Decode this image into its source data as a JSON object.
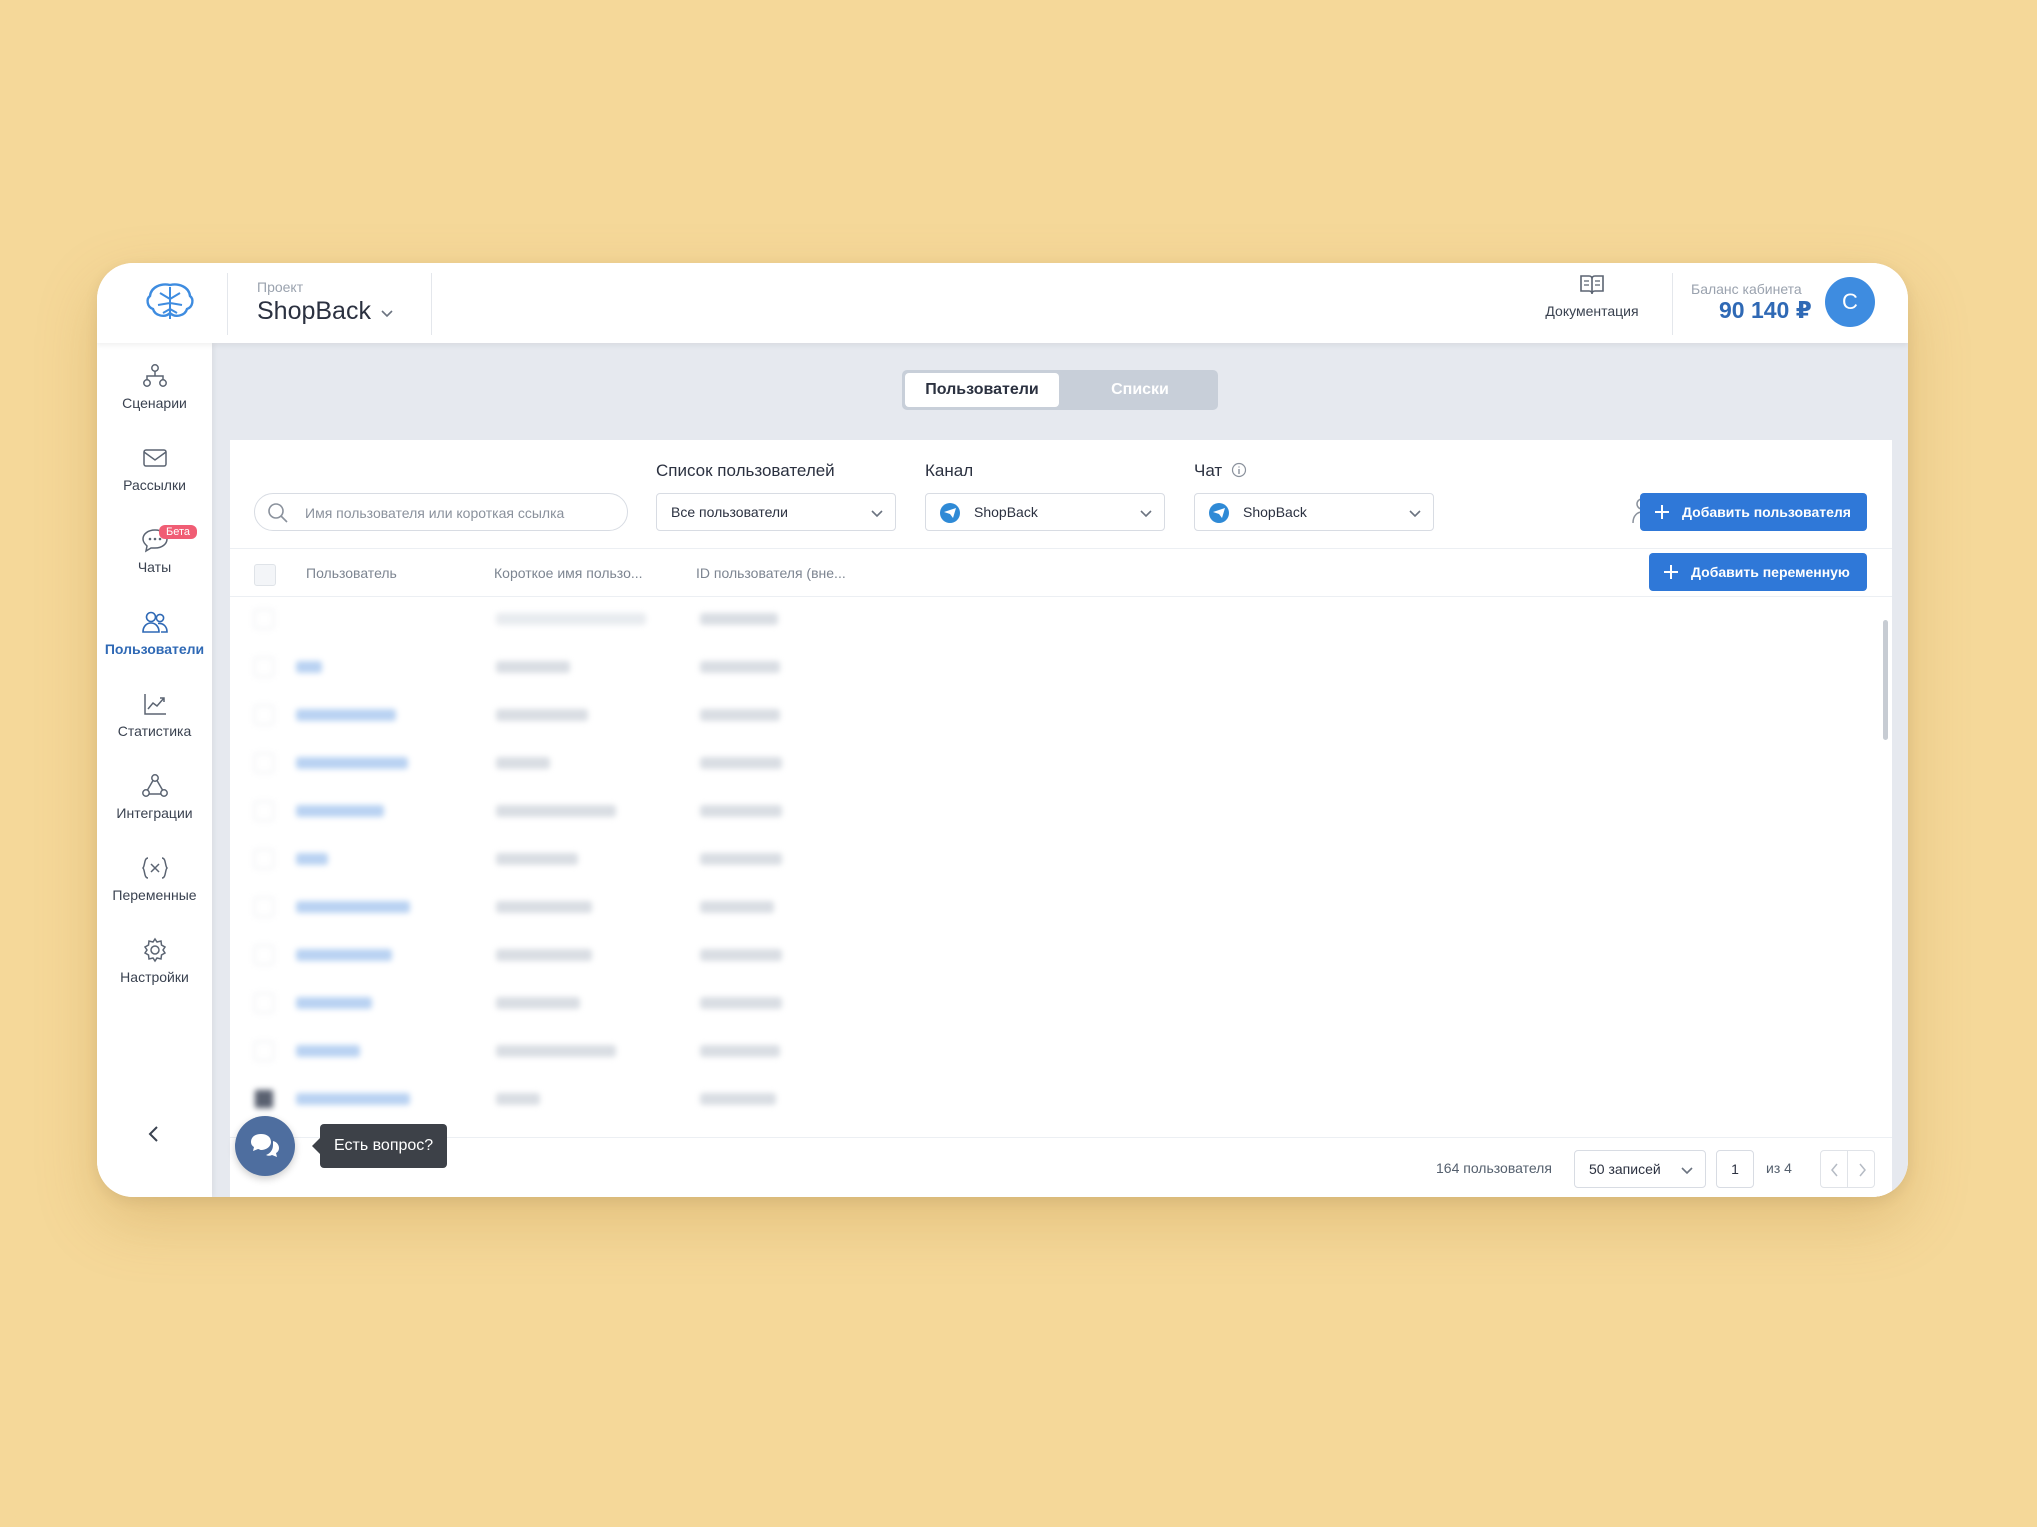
{
  "header": {
    "project_caption": "Проект",
    "project_name": "ShopBack",
    "docs_label": "Документация",
    "balance_caption": "Баланс кабинета",
    "balance_value": "90 140 ₽",
    "avatar_letter": "С"
  },
  "sidebar": {
    "items": [
      {
        "label": "Сценарии",
        "icon": "scenarios-icon"
      },
      {
        "label": "Рассылки",
        "icon": "mail-icon"
      },
      {
        "label": "Чаты",
        "icon": "chat-icon",
        "badge": "Бета"
      },
      {
        "label": "Пользователи",
        "icon": "users-icon",
        "active": true
      },
      {
        "label": "Статистика",
        "icon": "chart-icon"
      },
      {
        "label": "Интеграции",
        "icon": "integrations-icon"
      },
      {
        "label": "Переменные",
        "icon": "variables-icon"
      },
      {
        "label": "Настройки",
        "icon": "gear-icon"
      }
    ]
  },
  "tabs": {
    "active": "Пользователи",
    "inactive": "Списки"
  },
  "filters": {
    "search_placeholder": "Имя пользователя или короткая ссылка",
    "list_label": "Список пользователей",
    "list_value": "Все пользователи",
    "channel_label": "Канал",
    "channel_value": "ShopBack",
    "chat_label": "Чат",
    "chat_value": "ShopBack",
    "add_user_button": "Добавить пользователя"
  },
  "table": {
    "columns": [
      "Пользователь",
      "Короткое имя пользо...",
      "ID пользователя (вне..."
    ],
    "add_variable_button": "Добавить переменную"
  },
  "footer": {
    "count": "164 пользователя",
    "per_page": "50 записей",
    "page": "1",
    "page_of": "из 4"
  },
  "help": {
    "tooltip": "Есть вопрос?"
  },
  "colors": {
    "background": "#F5D899",
    "accent": "#2f78d8",
    "brand_text": "#2f69b5",
    "beta_badge": "#f05d74"
  }
}
